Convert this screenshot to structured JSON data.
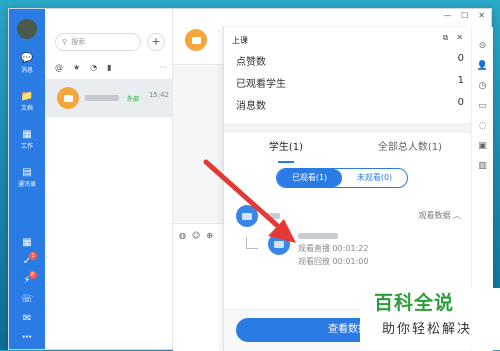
{
  "nav": {
    "items": [
      {
        "glyph": "💬",
        "label": "消息"
      },
      {
        "glyph": "📁",
        "label": "文档"
      },
      {
        "glyph": "▦",
        "label": "工作"
      },
      {
        "glyph": "▤",
        "label": "通讯录"
      }
    ],
    "bottom": [
      {
        "glyph": "▦",
        "badge": ""
      },
      {
        "glyph": "✓",
        "badge": "1"
      },
      {
        "glyph": "⚡",
        "badge": "8"
      },
      {
        "glyph": "☏",
        "badge": ""
      },
      {
        "glyph": "✉",
        "badge": ""
      },
      {
        "glyph": "⋯",
        "badge": ""
      }
    ]
  },
  "list": {
    "search_placeholder": "搜索",
    "add": "+",
    "filters": [
      "@",
      "★",
      "◔",
      "▮"
    ],
    "more": "···",
    "conversation": {
      "tag": "外部",
      "time": "15:42"
    }
  },
  "window": {
    "min": "—",
    "max": "☐",
    "close": "✕"
  },
  "panel": {
    "title": "上课",
    "controls": [
      "⧉",
      "✕"
    ],
    "stats": [
      {
        "label": "点赞数",
        "value": "0"
      },
      {
        "label": "已观看学生",
        "value": "1"
      },
      {
        "label": "消息数",
        "value": "0"
      }
    ],
    "tabs": [
      "学生(1)",
      "全部总人数(1)"
    ],
    "segments": [
      "已观看(1)",
      "未观看(0)"
    ],
    "view_data": "观看数据 ︿",
    "student": {
      "live": "观看直播 00:01:22",
      "replay": "观看回放 00:01:00"
    },
    "button": "查看数据"
  },
  "right_tools": [
    "⊝",
    "👤",
    "◷",
    "▭",
    "◌",
    "▣",
    "▥"
  ],
  "watermark": {
    "title": "百科全说",
    "subtitle": "助你轻松解决"
  },
  "colors": {
    "brand": "#2b7be4",
    "avatar": "#f6a53b",
    "arrow": "#e53935",
    "watermark": "#2c9e3c"
  }
}
